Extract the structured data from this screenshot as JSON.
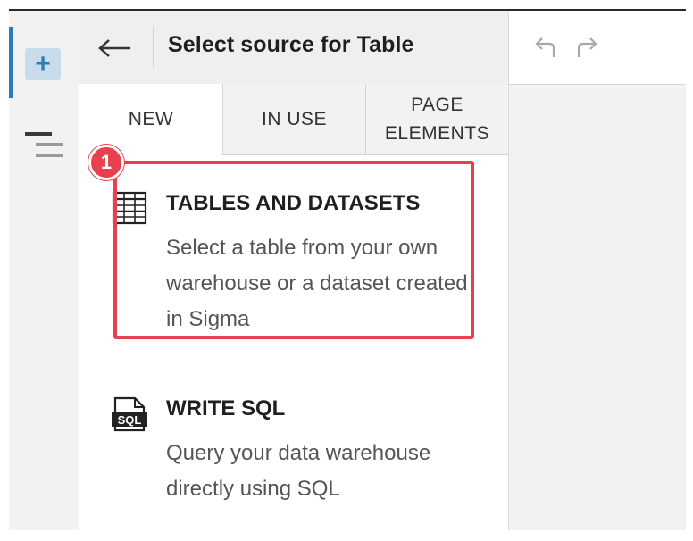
{
  "header": {
    "title": "Select source for Table"
  },
  "tabs": [
    {
      "label": "NEW"
    },
    {
      "label": "IN USE"
    },
    {
      "label": "PAGE\nELEMENTS"
    }
  ],
  "options": [
    {
      "title": "TABLES AND DATASETS",
      "description": "Select a table from your own warehouse or a dataset created in Sigma",
      "icon": "table-grid-icon"
    },
    {
      "title": "WRITE SQL",
      "description": "Query your data warehouse directly using SQL",
      "icon": "sql-file-icon",
      "icon_text": "SQL"
    }
  ],
  "annotation": {
    "badge": "1",
    "color": "#e8404f"
  },
  "rail": {
    "add_icon": "plus-icon",
    "layers_icon": "layers-icon",
    "accent": "#2b7cb8"
  },
  "toolbar": {
    "undo_icon": "undo-icon",
    "redo_icon": "redo-icon"
  }
}
